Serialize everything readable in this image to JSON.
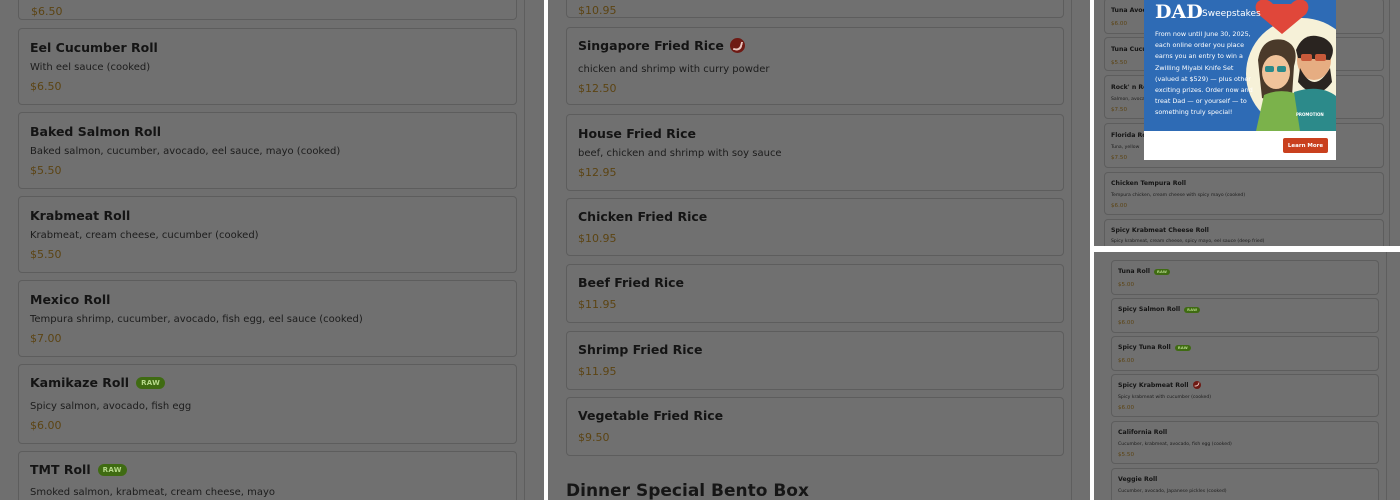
{
  "left_panel": {
    "top_price": "$6.50",
    "items": [
      {
        "name": "Eel Cucumber Roll",
        "desc": "With eel sauce (cooked)",
        "price": "$6.50"
      },
      {
        "name": "Baked Salmon Roll",
        "desc": "Baked salmon, cucumber, avocado, eel sauce, mayo (cooked)",
        "price": "$5.50"
      },
      {
        "name": "Krabmeat Roll",
        "desc": "Krabmeat, cream cheese, cucumber (cooked)",
        "price": "$5.50"
      },
      {
        "name": "Mexico Roll",
        "desc": "Tempura shrimp, cucumber, avocado, fish egg, eel sauce (cooked)",
        "price": "$7.00"
      },
      {
        "name": "Kamikaze Roll",
        "badge": "RAW",
        "desc": "Spicy salmon, avocado, fish egg",
        "price": "$6.00"
      },
      {
        "name": "TMT Roll",
        "badge": "RAW",
        "desc": "Smoked salmon, krabmeat, cream cheese, mayo"
      }
    ]
  },
  "mid_panel": {
    "top_price": "$10.95",
    "items": [
      {
        "name": "Singapore Fried Rice",
        "icon": "spicy-icon",
        "desc": "chicken and shrimp with curry powder",
        "price": "$12.50"
      },
      {
        "name": "House Fried Rice",
        "desc": "beef, chicken and shrimp with soy sauce",
        "price": "$12.95"
      },
      {
        "name": "Chicken Fried Rice",
        "price": "$10.95"
      },
      {
        "name": "Beef Fried Rice",
        "price": "$11.95"
      },
      {
        "name": "Shrimp Fried Rice",
        "price": "$11.95"
      },
      {
        "name": "Vegetable Fried Rice",
        "price": "$9.50"
      }
    ],
    "section_heading": "Dinner Special Bento Box"
  },
  "right_top_panel": {
    "items": [
      {
        "name": "Tuna Avoca",
        "price": "$6.00"
      },
      {
        "name": "Tuna Cucum",
        "price": "$5.50"
      },
      {
        "name": "Rock' n Rol",
        "desc": "Salmon, avoca",
        "price": "$7.50"
      },
      {
        "name": "Florida Rol",
        "desc": "Tuna, yellow",
        "price": "$7.50"
      },
      {
        "name": "Chicken Tempura Roll",
        "desc": "Tempura chicken, cream cheese with spicy mayo (cooked)",
        "price": "$6.00"
      },
      {
        "name": "Spicy Krabmeat Cheese Roll",
        "desc": "Spicy krabmeat, cream cheese, spicy mayo, eel sauce (deep fried)"
      }
    ],
    "popup": {
      "title_big": "DAD",
      "title_small": "Sweepstakes",
      "body": "From now until June 30, 2025, each online order you place earns you an entry to win a Zwilling Miyabi Knife Set (valued at $529) — plus other exciting prizes. Order now and treat Dad — or yourself — to something truly special!",
      "cta": "Learn More",
      "art_stamp": "PROMOTION"
    }
  },
  "right_bottom_panel": {
    "items": [
      {
        "name": "Tuna Roll",
        "badge": "RAW",
        "price": "$5.00"
      },
      {
        "name": "Spicy Salmon Roll",
        "badge": "RAW",
        "price": "$6.00"
      },
      {
        "name": "Spicy Tuna Roll",
        "badge": "RAW",
        "price": "$6.00"
      },
      {
        "name": "Spicy Krabmeat Roll",
        "icon": "spicy-icon",
        "desc": "Spicy krabmeat with cucumber (cooked)",
        "price": "$6.00"
      },
      {
        "name": "California Roll",
        "desc": "Cucumber, krabmeat, avocado, fish egg (cooked)",
        "price": "$5.50"
      },
      {
        "name": "Veggie Roll",
        "desc": "Cucumber, avocado, Japanese pickles (cooked)"
      }
    ]
  },
  "colors": {
    "overlay_gray": "#6f6f6f",
    "price_brown": "#5c4413",
    "raw_badge_green": "#3f6b12",
    "spicy_red": "#6e1a14",
    "popup_blue": "#2e6bb5",
    "cta_orange": "#c9401e"
  }
}
